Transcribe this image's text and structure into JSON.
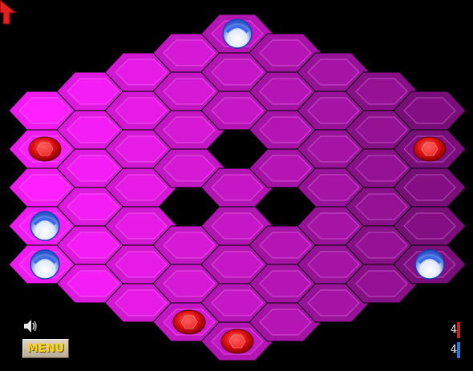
{
  "menu": {
    "label": "MENU"
  },
  "scores": {
    "red": "4",
    "blue": "4"
  },
  "icons": {
    "sound": "speaker-icon",
    "cursor": "arrow-cursor-icon"
  },
  "colors": {
    "red_team": "#d51f1f",
    "blue_team": "#1a7de0",
    "board": "#c020c0",
    "background": "#000000"
  },
  "board": {
    "columns": 9,
    "rows_per_column": [
      5,
      6,
      7,
      8,
      9,
      8,
      7,
      6,
      5
    ],
    "holes": [
      [
        4,
        3
      ],
      [
        3,
        4
      ],
      [
        5,
        4
      ]
    ],
    "red_pieces": [
      [
        0,
        1
      ],
      [
        3,
        7
      ],
      [
        4,
        8
      ],
      [
        8,
        1
      ]
    ],
    "blue_pieces": [
      [
        4,
        0
      ],
      [
        0,
        3
      ],
      [
        0,
        4
      ],
      [
        8,
        4
      ]
    ]
  }
}
